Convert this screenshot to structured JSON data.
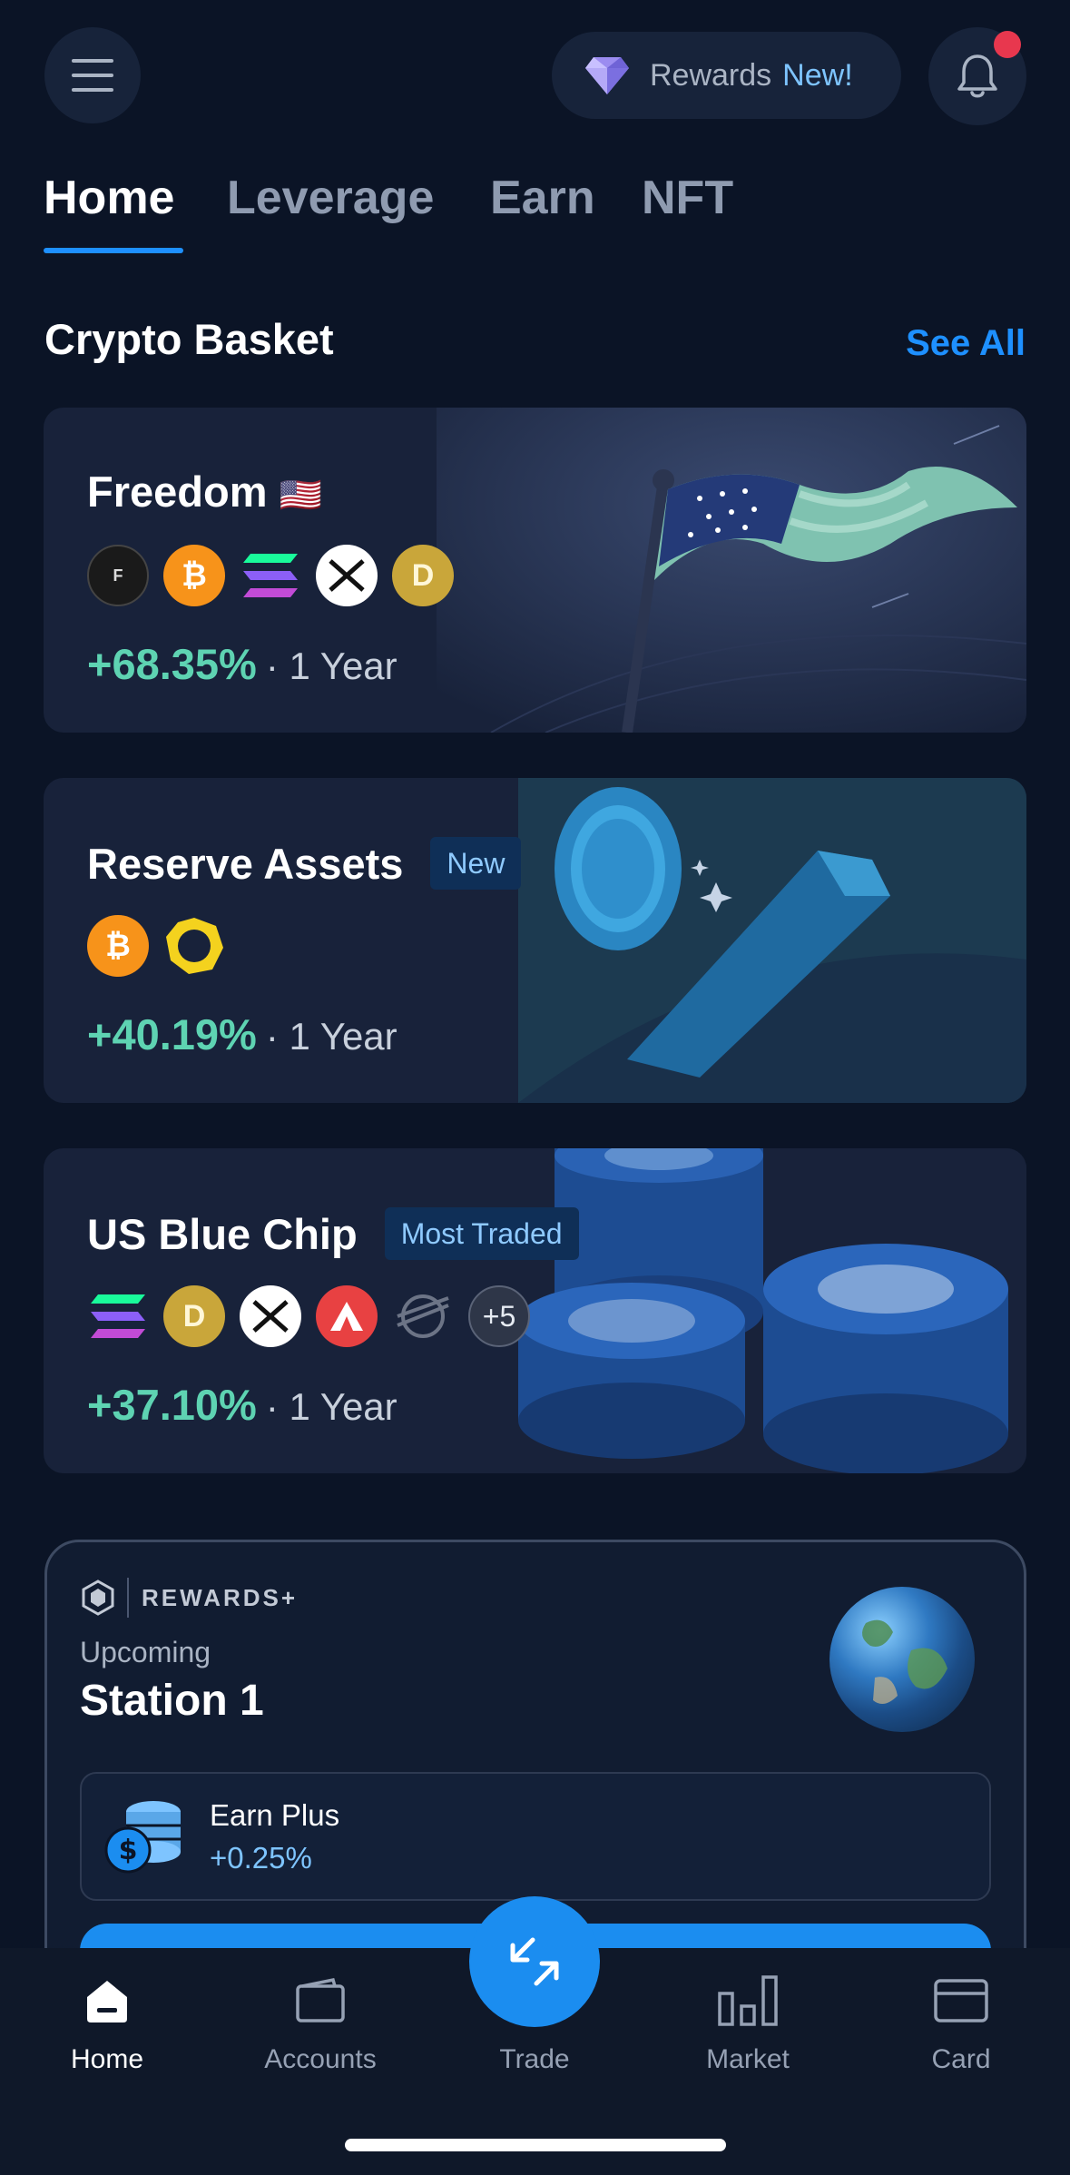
{
  "header": {
    "rewards_label": "Rewards",
    "rewards_badge": "New!"
  },
  "tabs": [
    {
      "label": "Home",
      "active": true
    },
    {
      "label": "Leverage",
      "active": false
    },
    {
      "label": "Earn",
      "active": false
    },
    {
      "label": "NFT",
      "active": false
    }
  ],
  "section": {
    "title": "Crypto Basket",
    "see_all": "See All"
  },
  "baskets": [
    {
      "name": "Freedom",
      "flag": "🇺🇸",
      "return": "+68.35%",
      "period": "· 1 Year",
      "coins": [
        "fight-coin-icon",
        "bitcoin-icon",
        "solana-icon",
        "xrp-icon",
        "dogecoin-icon"
      ]
    },
    {
      "name": "Reserve Assets",
      "tag": "New",
      "return": "+40.19%",
      "period": "· 1 Year",
      "coins": [
        "bitcoin-icon",
        "paxg-icon"
      ]
    },
    {
      "name": "US Blue Chip",
      "tag": "Most Traded",
      "return": "+37.10%",
      "period": "· 1 Year",
      "coins": [
        "solana-icon",
        "dogecoin-icon",
        "xrp-icon",
        "avalanche-icon",
        "stellar-icon"
      ],
      "more": "+5"
    }
  ],
  "rewards": {
    "brand": "REWARDS+",
    "upcoming": "Upcoming",
    "station": "Station 1",
    "earn_title": "Earn Plus",
    "earn_value": "+0.25%"
  },
  "nav": [
    {
      "label": "Home",
      "icon": "home-icon",
      "active": true
    },
    {
      "label": "Accounts",
      "icon": "wallet-icon",
      "active": false
    },
    {
      "label": "Trade",
      "icon": "swap-arrows-icon",
      "active": false
    },
    {
      "label": "Market",
      "icon": "bar-chart-icon",
      "active": false
    },
    {
      "label": "Card",
      "icon": "credit-card-icon",
      "active": false
    }
  ],
  "colors": {
    "background": "#0b1426",
    "accent": "#1e90ff",
    "positive": "#5ed3b2",
    "notification": "#e8374e"
  }
}
